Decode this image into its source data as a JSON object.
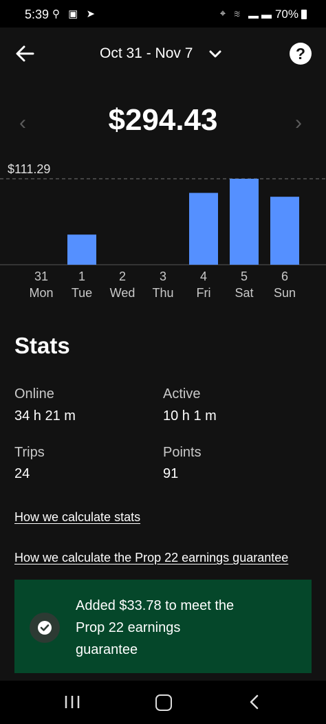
{
  "status_bar": {
    "time": "5:39",
    "battery": "70%"
  },
  "header": {
    "date_range": "Oct 31 - Nov 7"
  },
  "summary": {
    "total": "$294.43",
    "prev_icon": "chevron-left-icon",
    "next_icon": "chevron-right-icon"
  },
  "chart_data": {
    "type": "bar",
    "categories": [
      "Mon",
      "Tue",
      "Wed",
      "Thu",
      "Fri",
      "Sat",
      "Sun"
    ],
    "day_numbers": [
      "31",
      "1",
      "2",
      "3",
      "4",
      "5",
      "6"
    ],
    "values": [
      0,
      39,
      0,
      0,
      93,
      111.29,
      88
    ],
    "max_label": "$111.29",
    "ylim": [
      0,
      111.29
    ],
    "color": "#5590ff"
  },
  "stats": {
    "title": "Stats",
    "online_label": "Online",
    "online_value": "34 h 21 m",
    "active_label": "Active",
    "active_value": "10 h 1 m",
    "trips_label": "Trips",
    "trips_value": "24",
    "points_label": "Points",
    "points_value": "91"
  },
  "links": {
    "calc_stats": "How we calculate stats",
    "calc_prop22": "How we calculate the Prop 22 earnings guarantee"
  },
  "banner": {
    "text": "Added $33.78 to meet the Prop 22 earnings guarantee",
    "color": "#05472a",
    "icon": "check-circle-icon"
  }
}
